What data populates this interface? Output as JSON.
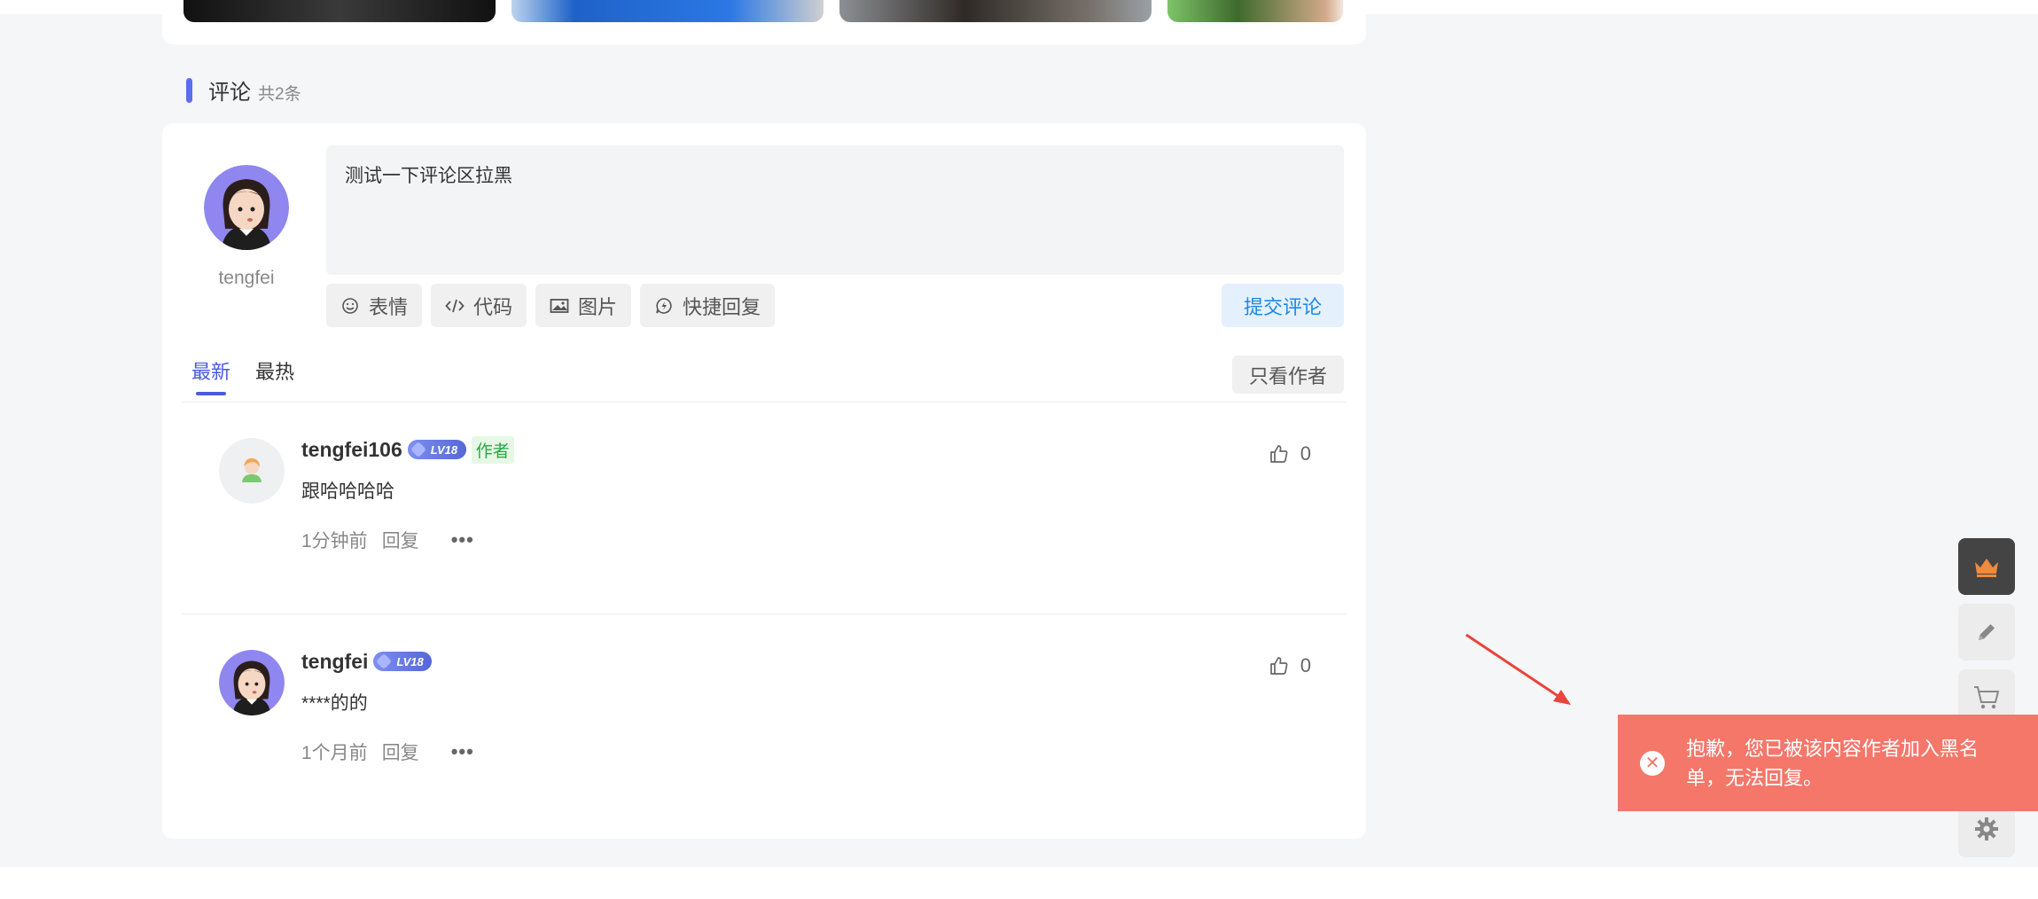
{
  "section": {
    "title": "评论",
    "count": "共2条"
  },
  "composer": {
    "user_name": "tengfei",
    "text": "测试一下评论区拉黑",
    "tools": [
      {
        "label": "表情",
        "icon": "smile-icon"
      },
      {
        "label": "代码",
        "icon": "code-icon"
      },
      {
        "label": "图片",
        "icon": "image-icon"
      },
      {
        "label": "快捷回复",
        "icon": "quick-reply-icon"
      }
    ],
    "submit_label": "提交评论"
  },
  "tabs": [
    {
      "label": "最新",
      "active": true
    },
    {
      "label": "最热",
      "active": false
    }
  ],
  "only_author_label": "只看作者",
  "comments": [
    {
      "user": "tengfei106",
      "level": "LV18",
      "author_tag": "作者",
      "text": "跟哈哈哈哈",
      "time": "1分钟前",
      "reply": "回复",
      "more": "•••",
      "likes": "0"
    },
    {
      "user": "tengfei",
      "level": "LV18",
      "author_tag": "",
      "text": "****的的",
      "time": "1个月前",
      "reply": "回复",
      "more": "•••",
      "likes": "0"
    }
  ],
  "toast": {
    "message": "抱歉，您已被该内容作者加入黑名单，无法回复。",
    "icon": "close-circle-icon"
  },
  "side_tools": [
    "crown-icon",
    "pencil-icon",
    "cart-icon",
    "gear-icon"
  ],
  "colors": {
    "accent": "#4b5be0",
    "toast_bg": "#f4776a",
    "author_tag": "#27a744",
    "submit_text": "#1e88e5"
  }
}
